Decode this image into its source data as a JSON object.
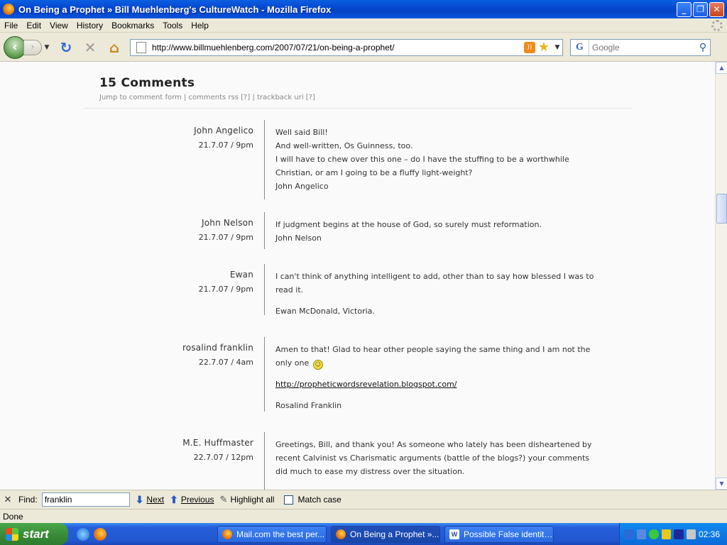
{
  "window": {
    "title": "On Being a Prophet » Bill Muehlenberg's CultureWatch - Mozilla Firefox"
  },
  "menu": [
    "File",
    "Edit",
    "View",
    "History",
    "Bookmarks",
    "Tools",
    "Help"
  ],
  "navbar": {
    "url": "http://www.billmuehlenberg.com/2007/07/21/on-being-a-prophet/",
    "search_placeholder": "Google"
  },
  "comments_header": {
    "title": "15 Comments",
    "link_form": "Jump to comment form",
    "link_rss": "comments rss [?]",
    "link_trackback": "trackback uri [?]"
  },
  "comments": [
    {
      "author": "John Angelico",
      "date": "21.7.07 / 9pm",
      "lines": [
        "Well said Bill!",
        "And well-written, Os Guinness, too.",
        "I will have to chew over this one – do I have the stuffing to be a worthwhile Christian, or am I going to be a fluffy light-weight?",
        "John Angelico"
      ]
    },
    {
      "author": "John Nelson",
      "date": "21.7.07 / 9pm",
      "lines": [
        "If judgment begins at the house of God, so surely must reformation.",
        "John Nelson"
      ]
    },
    {
      "author": "Ewan",
      "date": "21.7.07 / 9pm",
      "lines": [
        "I can't think of anything intelligent to add, other than to say how blessed I was to read it.",
        "Ewan McDonald, Victoria."
      ]
    },
    {
      "author": "rosalind franklin",
      "date": "22.7.07 / 4am",
      "lines": [
        "Amen to that! Glad to hear other people saying the same thing and I am not the only one",
        "http://propheticwordsrevelation.blogspot.com/",
        "Rosalind Franklin"
      ]
    },
    {
      "author": "M.E. Huffmaster",
      "date": "22.7.07 / 12pm",
      "lines": [
        "Greetings, Bill, and thank you! As someone who lately has been disheartened by recent Calvinist vs Charismatic arguments (battle of the blogs?) your comments did much to ease my distress over the situation."
      ]
    }
  ],
  "findbar": {
    "label": "Find:",
    "value": "franklin",
    "next": "Next",
    "previous": "Previous",
    "highlight": "Highlight all",
    "match_case": "Match case"
  },
  "status": "Done",
  "taskbar": {
    "start": "start",
    "tasks": [
      "Mail.com the best per...",
      "On Being a Prophet »...",
      "Possible False identiti..."
    ],
    "clock": "02:36"
  }
}
